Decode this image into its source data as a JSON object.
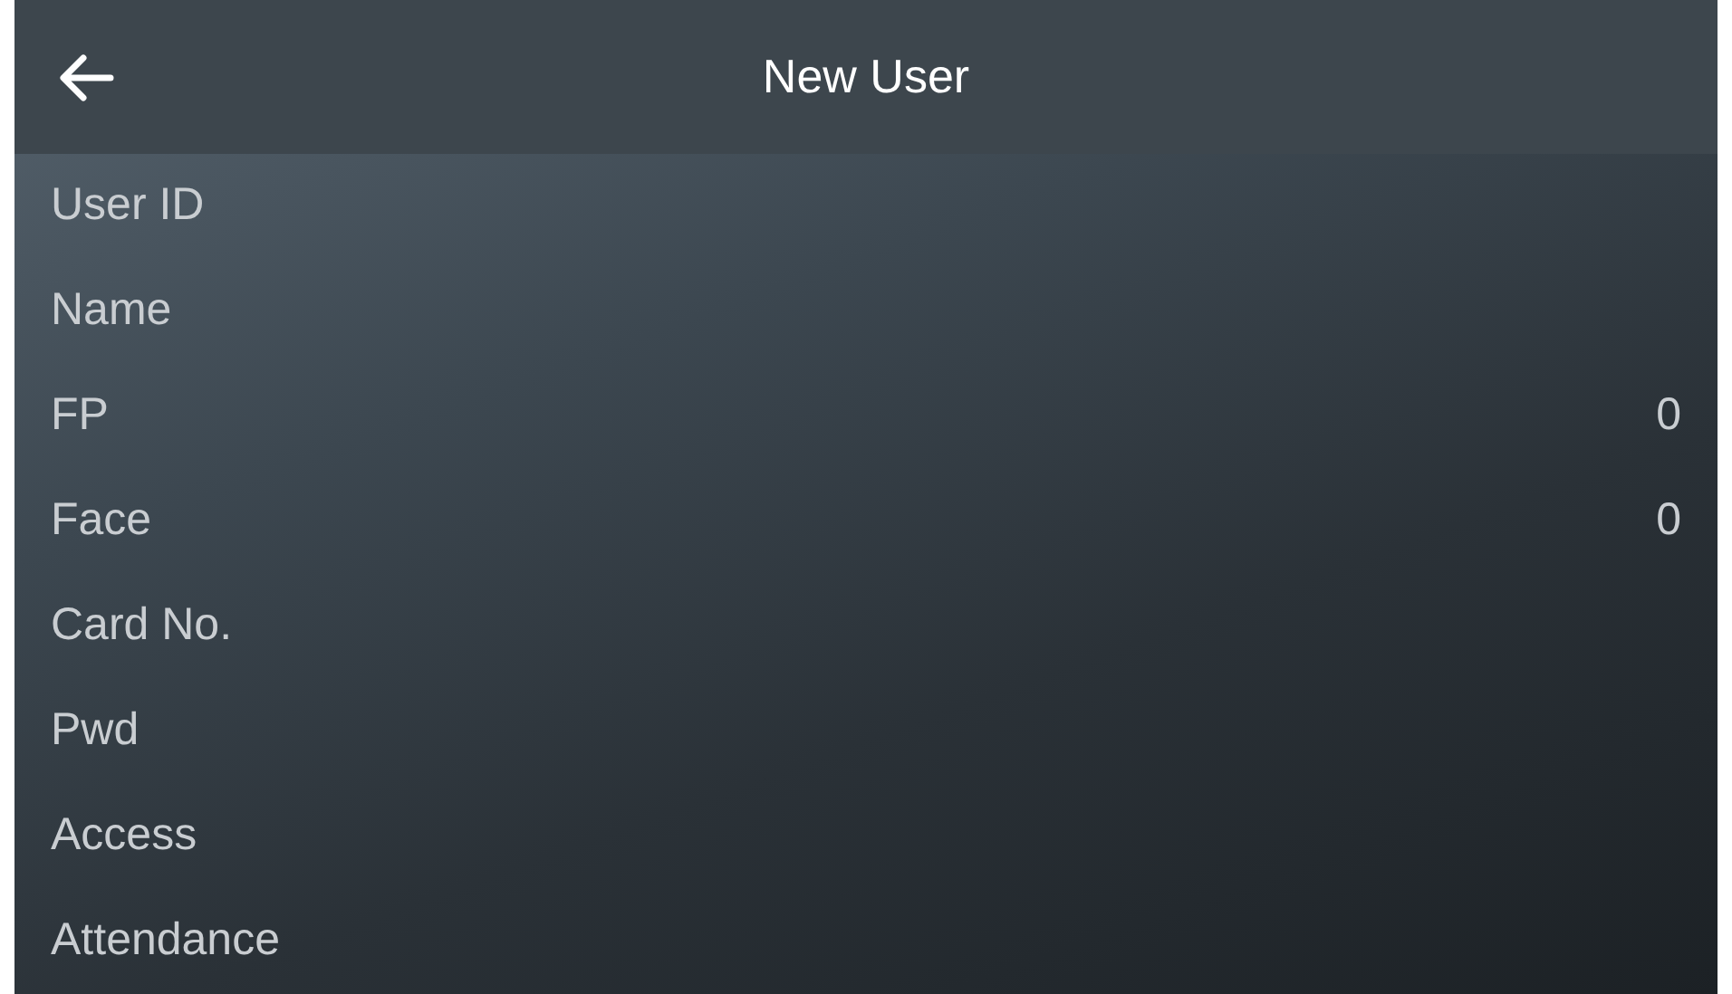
{
  "header": {
    "title": "New User"
  },
  "items": [
    {
      "label": "User ID"
    },
    {
      "label": "Name"
    },
    {
      "label": "FP",
      "value": "0"
    },
    {
      "label": "Face",
      "value": "0"
    },
    {
      "label": "Card No."
    },
    {
      "label": "Pwd"
    },
    {
      "label": "Access"
    },
    {
      "label": "Attendance"
    }
  ]
}
